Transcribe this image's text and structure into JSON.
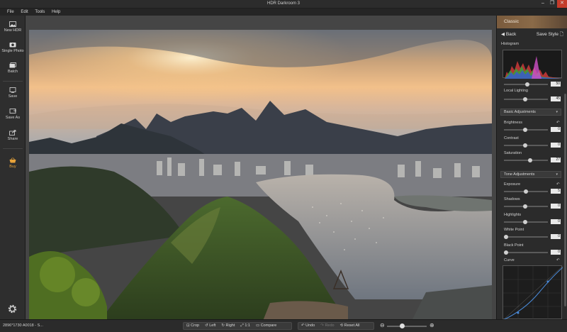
{
  "window": {
    "title": "HDR Darkroom 3"
  },
  "menu": {
    "items": [
      "File",
      "Edit",
      "Tools",
      "Help"
    ]
  },
  "leftbar": {
    "items": [
      {
        "label": "New HDR",
        "icon": "image-icon"
      },
      {
        "label": "Single Photo",
        "icon": "photo-icon"
      },
      {
        "label": "Batch",
        "icon": "batch-icon"
      },
      {
        "label": "Save",
        "icon": "save-icon"
      },
      {
        "label": "Save As",
        "icon": "save-as-icon"
      },
      {
        "label": "Share",
        "icon": "share-icon"
      },
      {
        "label": "Buy",
        "icon": "basket-icon"
      }
    ],
    "settings_icon": "gear-icon"
  },
  "panel": {
    "style_name": "Classic",
    "back_label": "Back",
    "save_style_label": "Save Style",
    "histogram_label": "Histogram",
    "hist_value": "50",
    "local_lighting": {
      "label": "Local Lighting",
      "value": "45"
    },
    "basic": {
      "title": "Basic Adjustments",
      "sliders": [
        {
          "label": "Brightness",
          "value": "0"
        },
        {
          "label": "Contrast",
          "value": "0"
        },
        {
          "label": "Saturation",
          "value": "27"
        }
      ]
    },
    "tone": {
      "title": "Tone Adjustments",
      "sliders": [
        {
          "label": "Exposure",
          "value": "5"
        },
        {
          "label": "Shadows",
          "value": "0"
        },
        {
          "label": "Highlights",
          "value": "0"
        },
        {
          "label": "White Point",
          "value": "0"
        },
        {
          "label": "Black Point",
          "value": "0"
        }
      ]
    },
    "curve_label": "Curve"
  },
  "status": {
    "text": "2896*1730 A0018 - S..."
  },
  "toolbar": {
    "crop": "Crop",
    "left": "Left",
    "right": "Right",
    "one_to_one": "1:1",
    "compare": "Compare",
    "undo": "Undo",
    "redo": "Redo",
    "reset_all": "Reset All"
  },
  "colors": {
    "accent": "#e8a33a",
    "header": "#7a5b3d",
    "close": "#c43b2b"
  }
}
